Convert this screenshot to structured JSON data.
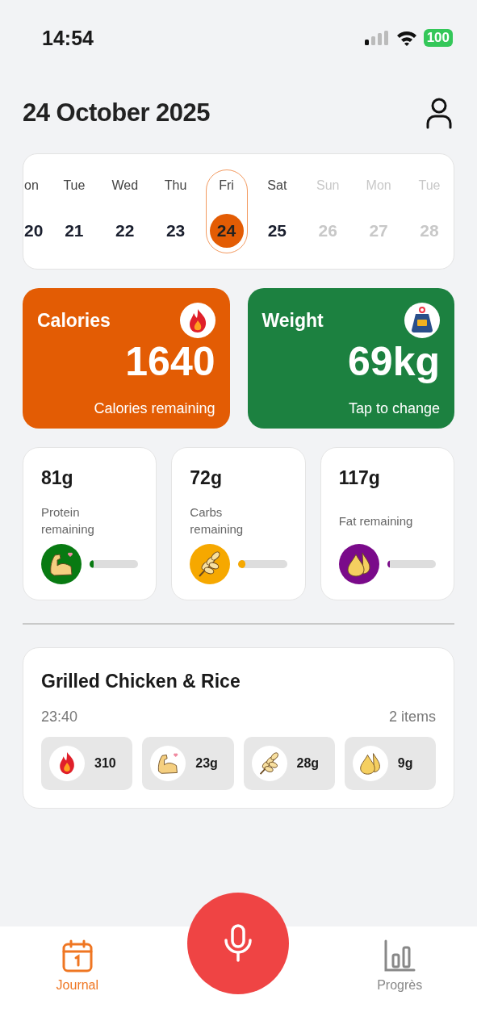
{
  "status_bar": {
    "time": "14:54",
    "battery": "100"
  },
  "header": {
    "title": "24 October 2025"
  },
  "calendar": {
    "days": [
      {
        "weekday": "on",
        "date": "20",
        "selected": false,
        "disabled": false
      },
      {
        "weekday": "Tue",
        "date": "21",
        "selected": false,
        "disabled": false
      },
      {
        "weekday": "Wed",
        "date": "22",
        "selected": false,
        "disabled": false
      },
      {
        "weekday": "Thu",
        "date": "23",
        "selected": false,
        "disabled": false
      },
      {
        "weekday": "Fri",
        "date": "24",
        "selected": true,
        "disabled": false
      },
      {
        "weekday": "Sat",
        "date": "25",
        "selected": false,
        "disabled": false
      },
      {
        "weekday": "Sun",
        "date": "26",
        "selected": false,
        "disabled": true
      },
      {
        "weekday": "Mon",
        "date": "27",
        "selected": false,
        "disabled": true
      },
      {
        "weekday": "Tue",
        "date": "28",
        "selected": false,
        "disabled": true
      }
    ]
  },
  "summary": [
    {
      "kind": "calories",
      "title": "Calories",
      "value": "1640",
      "caption": "Calories remaining",
      "color": "#e35c04"
    },
    {
      "kind": "weight",
      "title": "Weight",
      "value": "69kg",
      "caption": "Tap to change",
      "color": "#1c8140"
    }
  ],
  "macros": [
    {
      "kind": "protein",
      "value": "81g",
      "label": "Protein remaining",
      "color": "#087a12",
      "level": 0.08
    },
    {
      "kind": "carbs",
      "value": "72g",
      "label": "Carbs remaining",
      "color": "#f6a800",
      "level": 0.15
    },
    {
      "kind": "fat",
      "value": "117g",
      "label": "Fat remaining",
      "color": "#7a0a8a",
      "level": 0.02
    }
  ],
  "meals": [
    {
      "title": "Grilled Chicken & Rice",
      "time": "23:40",
      "items": "2 items",
      "nutrients": [
        {
          "kind": "calories",
          "value": "310"
        },
        {
          "kind": "protein",
          "value": "23g"
        },
        {
          "kind": "carbs",
          "value": "28g"
        },
        {
          "kind": "fat",
          "value": "9g"
        }
      ]
    }
  ],
  "nav": [
    {
      "kind": "journal",
      "label": "Journal",
      "selected": true
    },
    {
      "kind": "mic"
    },
    {
      "kind": "progress",
      "label": "Progrès",
      "selected": false
    }
  ]
}
